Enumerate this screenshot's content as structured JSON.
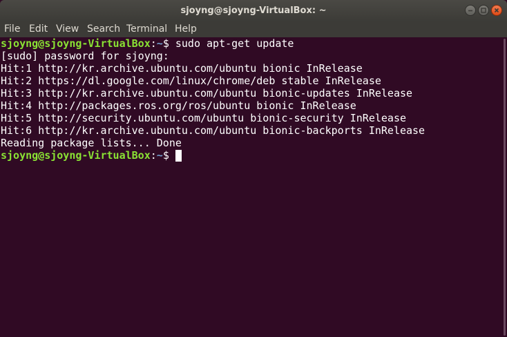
{
  "window": {
    "title": "sjoyng@sjoyng-VirtualBox: ~"
  },
  "menu": [
    "File",
    "Edit",
    "View",
    "Search",
    "Terminal",
    "Help"
  ],
  "prompt": {
    "user_host": "sjoyng@sjoyng-VirtualBox",
    "colon": ":",
    "path": "~",
    "symbol": "$ "
  },
  "command": "sudo apt-get update",
  "output": [
    "[sudo] password for sjoyng:",
    "Hit:1 http://kr.archive.ubuntu.com/ubuntu bionic InRelease",
    "Hit:2 https://dl.google.com/linux/chrome/deb stable InRelease",
    "Hit:3 http://kr.archive.ubuntu.com/ubuntu bionic-updates InRelease",
    "Hit:4 http://packages.ros.org/ros/ubuntu bionic InRelease",
    "Hit:5 http://security.ubuntu.com/ubuntu bionic-security InRelease",
    "Hit:6 http://kr.archive.ubuntu.com/ubuntu bionic-backports InRelease",
    "Reading package lists... Done"
  ],
  "colors": {
    "background": "#300a24",
    "prompt_user": "#8ae234",
    "prompt_path": "#729fcf",
    "text": "#ffffff",
    "titlebar": "#3c3b37"
  },
  "icons": {
    "minimize": "minimize-icon",
    "maximize": "maximize-icon",
    "close": "close-icon"
  }
}
